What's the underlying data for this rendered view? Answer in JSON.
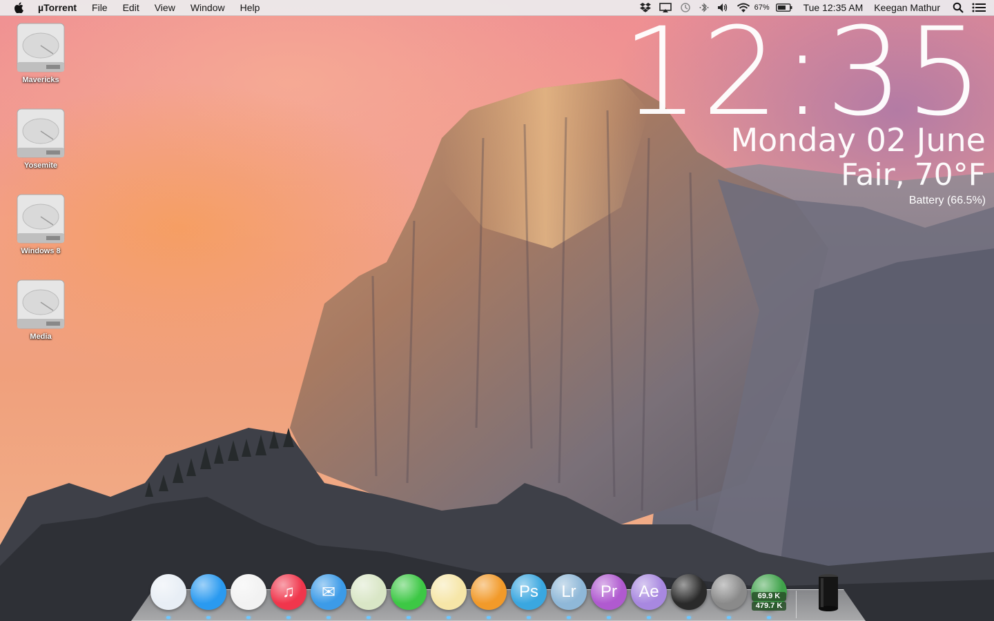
{
  "menubar": {
    "app_name": "µTorrent",
    "items": [
      "File",
      "Edit",
      "View",
      "Window",
      "Help"
    ],
    "status_icons": [
      "dropbox-icon",
      "airplay-icon",
      "time-machine-icon",
      "bluetooth-icon",
      "volume-icon",
      "wifi-icon"
    ],
    "battery_percent": "67%",
    "clock": "Tue 12:35 AM",
    "user": "Keegan Mathur"
  },
  "desktop_icons": [
    {
      "label": "Mavericks",
      "icon": "hard-drive-icon"
    },
    {
      "label": "Yosemite",
      "icon": "hard-drive-icon"
    },
    {
      "label": "Windows 8",
      "icon": "hard-drive-icon"
    },
    {
      "label": "Media",
      "icon": "hard-drive-icon"
    }
  ],
  "widget": {
    "time": "12:35",
    "date": "Monday 02 June",
    "weather": "Fair, 70°F",
    "battery": "Battery (66.5%)"
  },
  "dock": {
    "apps": [
      {
        "name": "finder-icon",
        "color": "#e8eef5",
        "glyph": ""
      },
      {
        "name": "safari-icon",
        "color": "#2a9af0",
        "glyph": ""
      },
      {
        "name": "chrome-icon",
        "color": "#f2f2f2",
        "glyph": ""
      },
      {
        "name": "itunes-icon",
        "color": "#f0364c",
        "glyph": "♫"
      },
      {
        "name": "mail-icon",
        "color": "#3c9be8",
        "glyph": "✉"
      },
      {
        "name": "maps-icon",
        "color": "#d9e6c6",
        "glyph": ""
      },
      {
        "name": "facetime-icon",
        "color": "#3dc845",
        "glyph": ""
      },
      {
        "name": "notes-icon",
        "color": "#f6e6a8",
        "glyph": ""
      },
      {
        "name": "pages-icon",
        "color": "#f29a2a",
        "glyph": ""
      },
      {
        "name": "photoshop-icon",
        "color": "#3aa7e0",
        "glyph": "Ps"
      },
      {
        "name": "lightroom-icon",
        "color": "#8fb8d8",
        "glyph": "Lr"
      },
      {
        "name": "premiere-icon",
        "color": "#b05ad0",
        "glyph": "Pr"
      },
      {
        "name": "after-effects-icon",
        "color": "#a888e0",
        "glyph": "Ae"
      },
      {
        "name": "final-cut-icon",
        "color": "#2a2a2a",
        "glyph": ""
      },
      {
        "name": "system-preferences-icon",
        "color": "#8a8a8a",
        "glyph": ""
      },
      {
        "name": "utorrent-icon",
        "color": "#3fa34a",
        "glyph": ""
      }
    ],
    "utorrent_down": "69.9 K",
    "utorrent_up": "479.7 K",
    "trash": "mac-pro-icon"
  }
}
